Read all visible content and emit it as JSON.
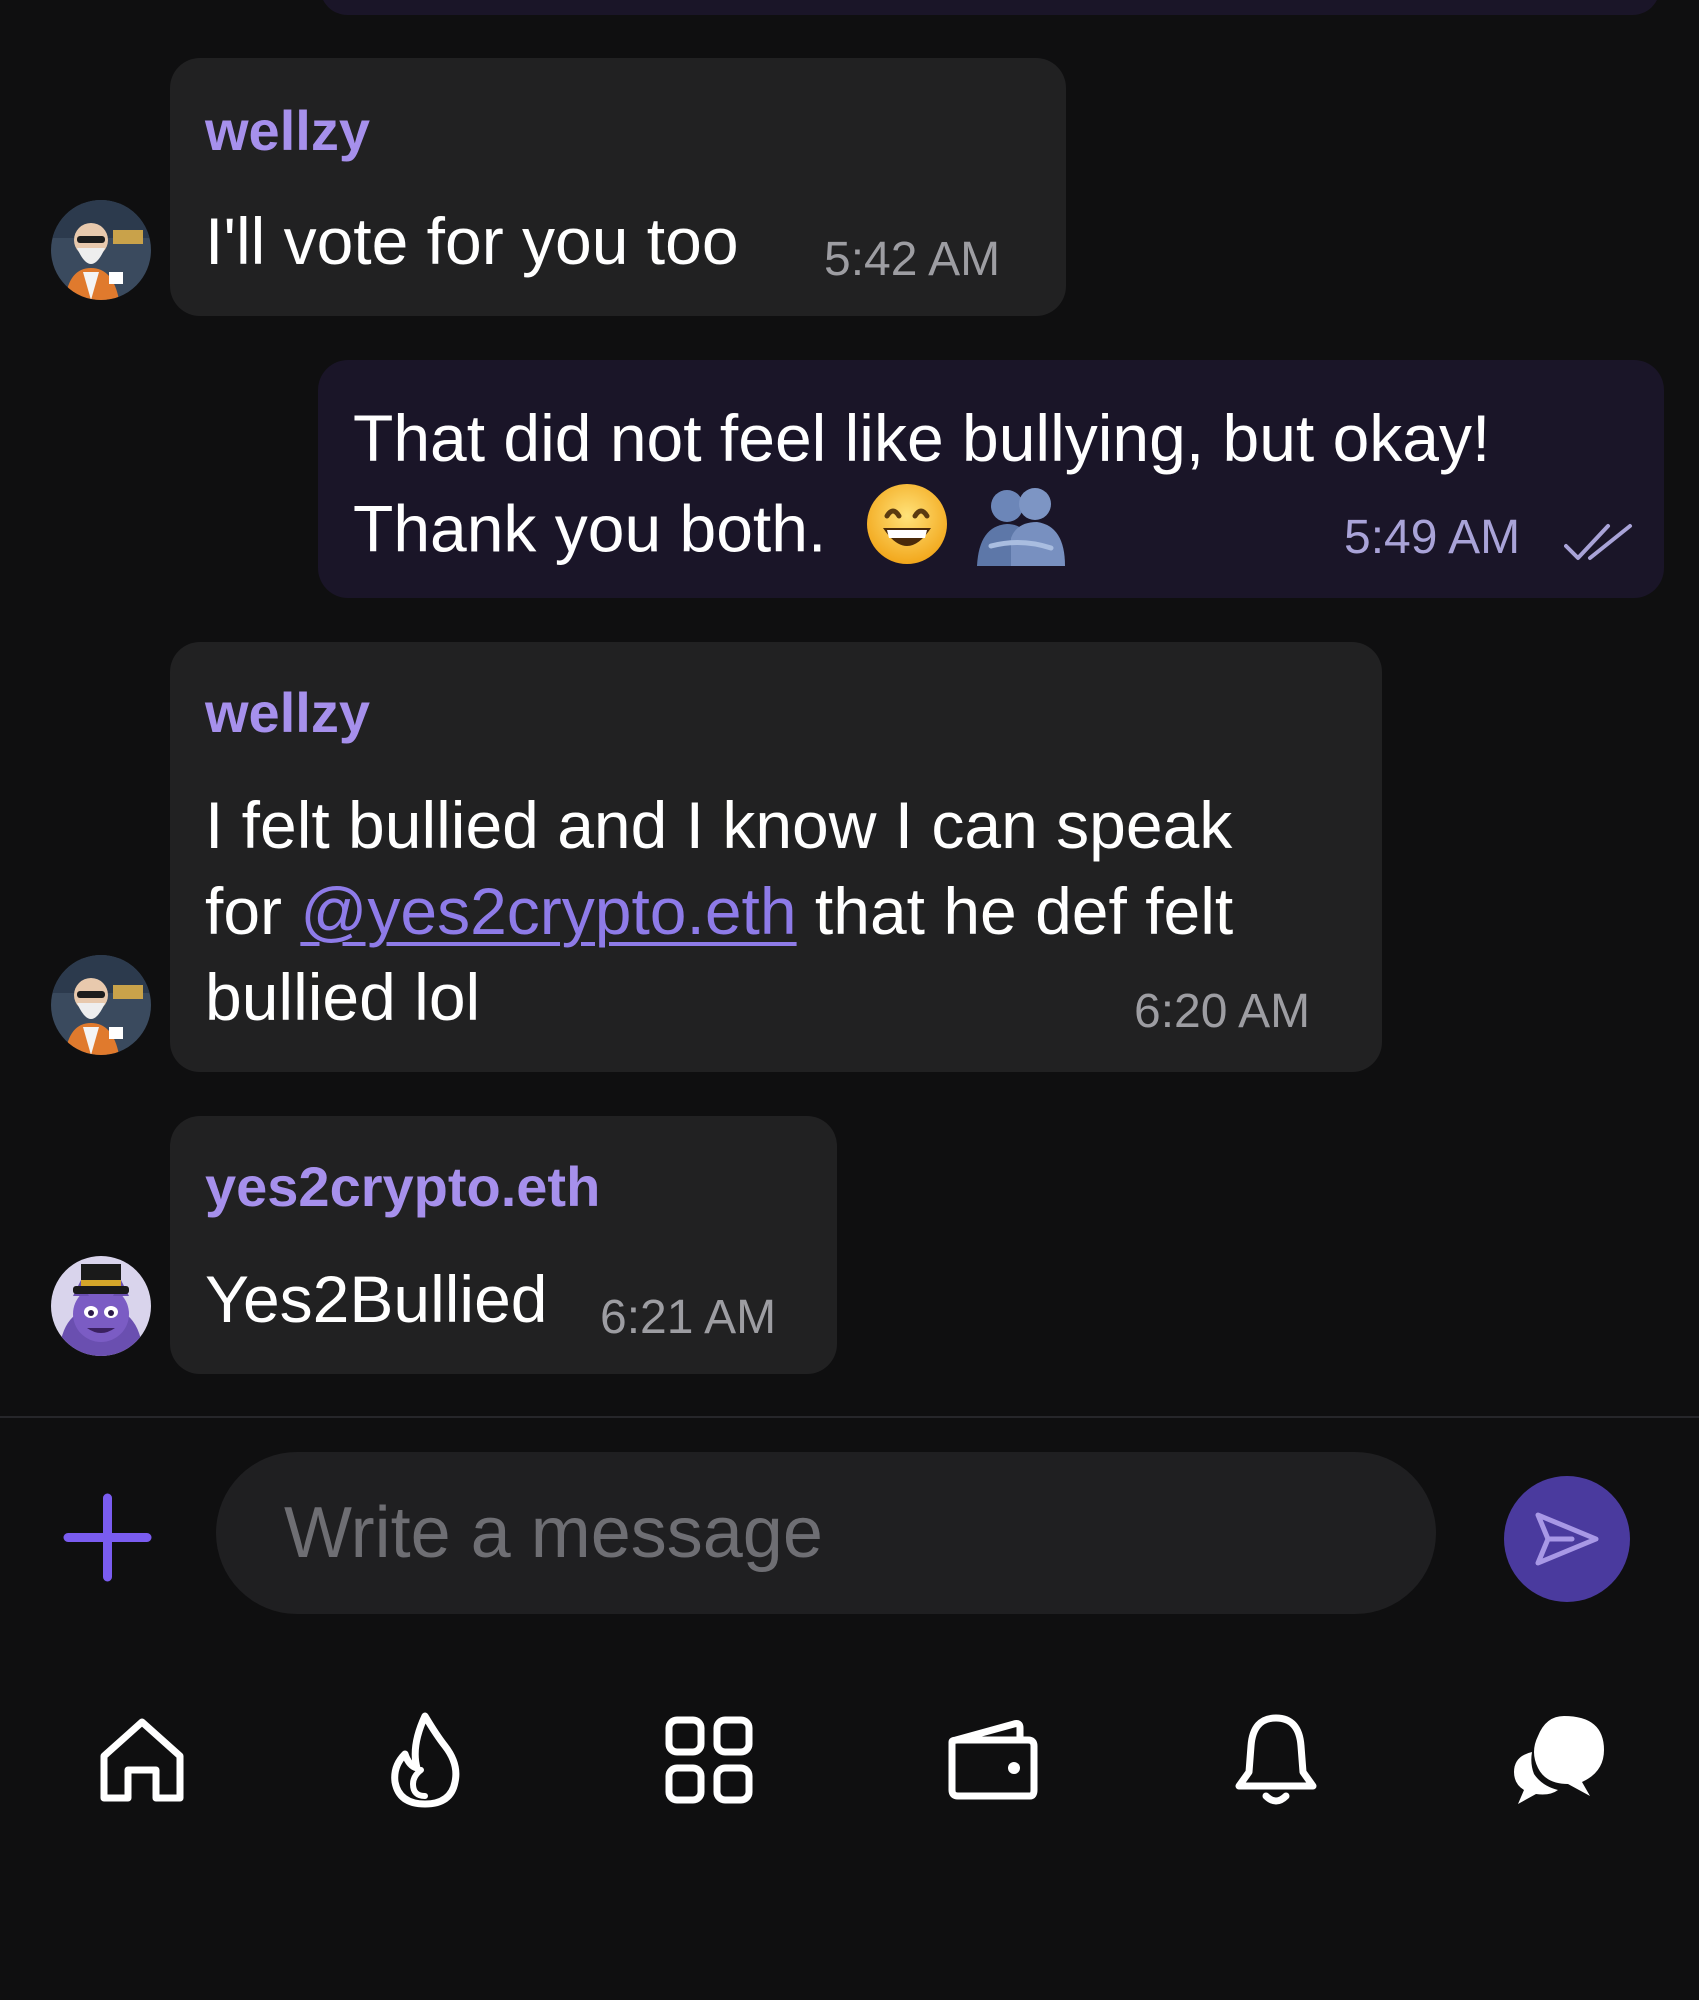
{
  "messages": [
    {
      "direction": "in",
      "sender": "wellzy",
      "avatar": "bearded-man-avatar",
      "text": "I'll vote for you too",
      "time": "5:42 AM"
    },
    {
      "direction": "out",
      "line1": "That did not feel like bullying, but okay!",
      "line2": "Thank you both.",
      "emojis": [
        "grinning-face-emoji",
        "hugging-people-emoji"
      ],
      "time": "5:49 AM",
      "status_icon": "double-check-icon"
    },
    {
      "direction": "in",
      "sender": "wellzy",
      "avatar": "bearded-man-avatar",
      "line1": "I felt bullied and I know I can speak",
      "line2_prefix": "for ",
      "mention": "@yes2crypto.eth",
      "line2_suffix": " that he def felt",
      "line3": "bullied lol",
      "time": "6:20 AM"
    },
    {
      "direction": "in",
      "sender": "yes2crypto.eth",
      "avatar": "purple-creature-top-hat-avatar",
      "text": "Yes2Bullied",
      "time": "6:21 AM"
    }
  ],
  "composer": {
    "placeholder": "Write a message",
    "add_icon": "plus-icon",
    "send_icon": "send-icon"
  },
  "nav": {
    "items": [
      "home-icon",
      "flame-icon",
      "apps-grid-icon",
      "wallet-icon",
      "bell-icon",
      "chat-icon"
    ]
  },
  "colors": {
    "background": "#0f0f10",
    "incoming_bubble": "#212122",
    "outgoing_bubble": "#1a1528",
    "accent": "#8e7be8",
    "sender_name": "#a690ec",
    "send_button": "#4a3a9e"
  }
}
